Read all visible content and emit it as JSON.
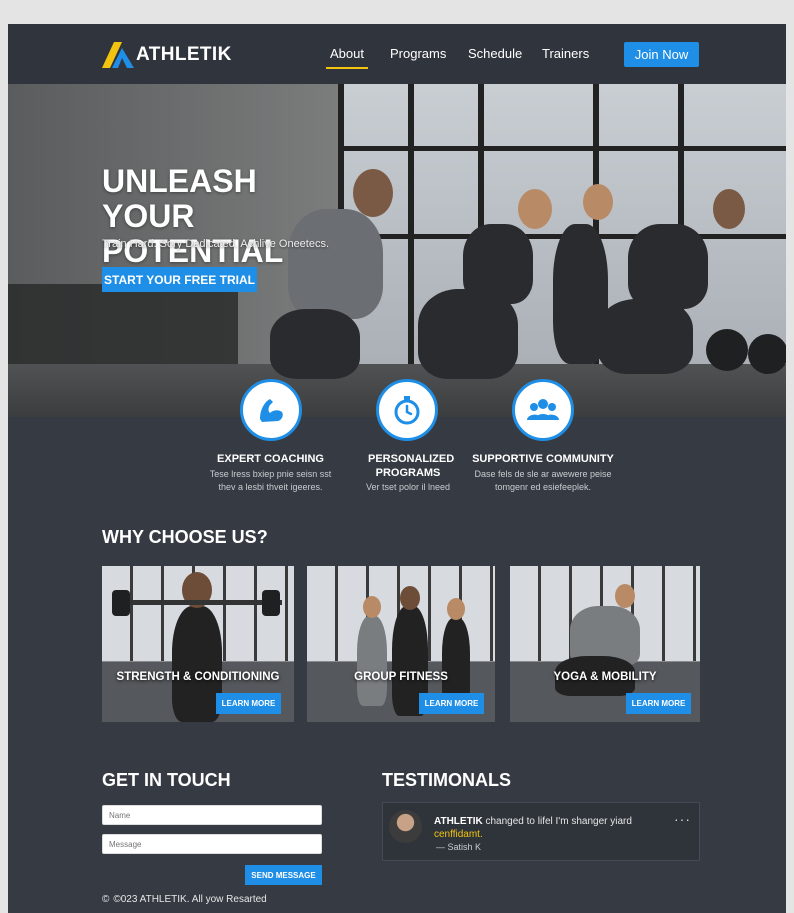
{
  "brand": {
    "name": "ATHLETIK"
  },
  "nav": {
    "items": [
      {
        "label": "About",
        "active": true
      },
      {
        "label": "Programs",
        "active": false
      },
      {
        "label": "Schedule",
        "active": false
      },
      {
        "label": "Trainers",
        "active": false
      }
    ],
    "join_label": "Join Now"
  },
  "hero": {
    "title": "UNLEASH YOUR POTENTIAL",
    "subtitle": "Train Hard. Sory Dedicated. Achlive Oneetecs.",
    "cta_label": "START YOUR FREE TRIAL"
  },
  "features": [
    {
      "icon": "flexed-arm-icon",
      "title": "EXPERT COACHING",
      "desc": "Tese lress bxiep pnie seisn sst thev a lesbi thveit igeeres."
    },
    {
      "icon": "stopwatch-icon",
      "title": "PERSONALIZED PROGRAMS",
      "desc": "Ver tset polor il lneed"
    },
    {
      "icon": "community-icon",
      "title": "SUPPORTIVE COMMUNITY",
      "desc": "Dase fels de sle ar awewere peise tomgenr ed esiefeeplek."
    }
  ],
  "why": {
    "heading": "WHY CHOOSE US?",
    "cards": [
      {
        "title": "STRENGTH & CONDITIONING",
        "button": "LEARN MORE"
      },
      {
        "title": "GROUP FITNESS",
        "button": "LEARN MORE"
      },
      {
        "title": "YOGA & MOBILITY",
        "button": "LEARN MORE"
      }
    ]
  },
  "contact": {
    "heading": "GET IN TOUCH",
    "name_placeholder": "Name",
    "message_placeholder": "Message",
    "send_label": "SEND MESSAGE"
  },
  "testimonials": {
    "heading": "TESTIMONALS",
    "quote_brand": "ATHLETIK",
    "quote_text": "changed to lifel I'm shanger yiard",
    "quote_highlight": "cenffidamt.",
    "author": "— Satish K"
  },
  "footer": {
    "copyright": "©023 ATHLETIK. All yow Resarted"
  },
  "colors": {
    "accent": "#1e8ee6",
    "highlight": "#f2c40f",
    "background": "#363b43"
  }
}
